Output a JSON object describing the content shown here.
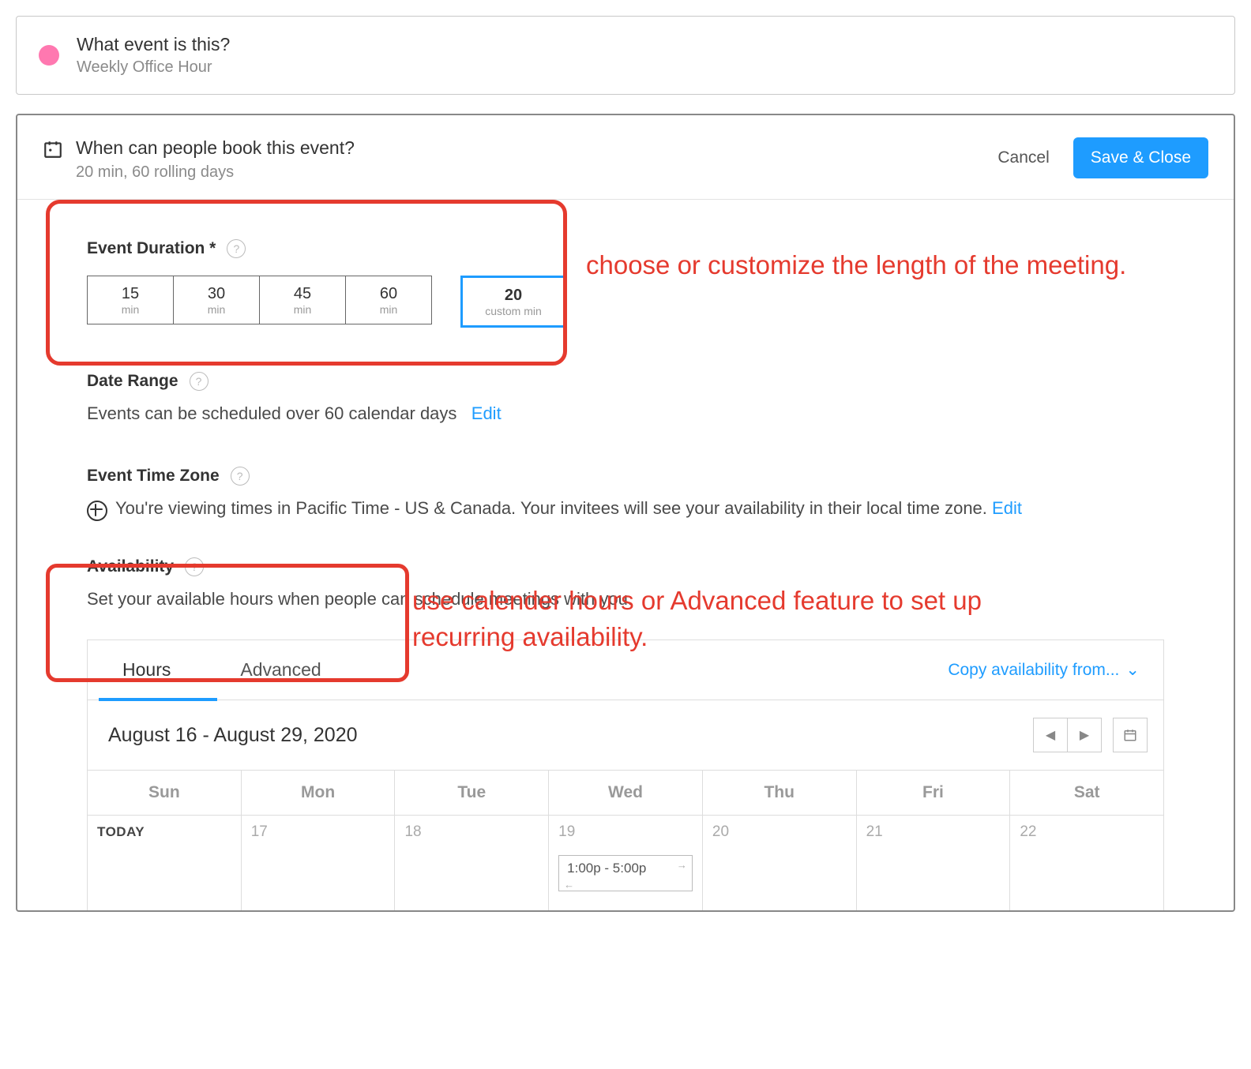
{
  "card1": {
    "title": "What event is this?",
    "subtitle": "Weekly Office Hour"
  },
  "card2": {
    "title": "When can people book this event?",
    "subtitle": "20 min, 60 rolling days",
    "cancel": "Cancel",
    "save": "Save & Close"
  },
  "annotations": {
    "a1": "choose or customize the length of the meeting.",
    "a2": "use calender hours or Advanced feature to set up recurring availability."
  },
  "duration": {
    "label": "Event Duration *",
    "presets": [
      {
        "n": "15",
        "u": "min"
      },
      {
        "n": "30",
        "u": "min"
      },
      {
        "n": "45",
        "u": "min"
      },
      {
        "n": "60",
        "u": "min"
      }
    ],
    "custom": {
      "n": "20",
      "u": "custom min"
    }
  },
  "dateRange": {
    "label": "Date Range",
    "text": "Events can be scheduled over 60 calendar days",
    "edit": "Edit"
  },
  "tz": {
    "label": "Event Time Zone",
    "text": "You're viewing times in Pacific Time - US & Canada. Your invitees will see your availability in their local time zone.",
    "edit": "Edit"
  },
  "availability": {
    "label": "Availability",
    "text": "Set your available hours when people can schedule meetings with you."
  },
  "tabs": {
    "hours": "Hours",
    "advanced": "Advanced",
    "copy": "Copy availability from..."
  },
  "calendar": {
    "range": "August 16 - August 29, 2020",
    "days": [
      "Sun",
      "Mon",
      "Tue",
      "Wed",
      "Thu",
      "Fri",
      "Sat"
    ],
    "cells": [
      {
        "label": "TODAY",
        "today": true
      },
      {
        "label": "17"
      },
      {
        "label": "18"
      },
      {
        "label": "19",
        "slot": "1:00p - 5:00p"
      },
      {
        "label": "20"
      },
      {
        "label": "21"
      },
      {
        "label": "22"
      }
    ]
  }
}
